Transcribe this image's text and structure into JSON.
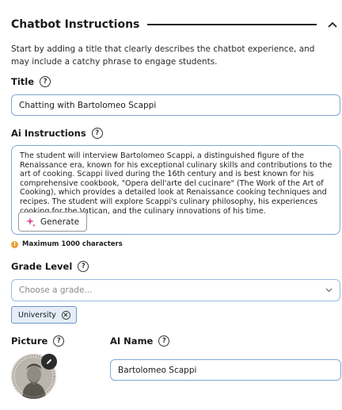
{
  "section": {
    "title": "Chatbot Instructions",
    "collapse_icon": "chevron-up-icon"
  },
  "intro": "Start by adding a title that clearly describes the chatbot experience, and may include a catchy phrase to engage students.",
  "title_field": {
    "label": "Title",
    "help": "?",
    "value": "Chatting with Bartolomeo Scappi"
  },
  "ai_instructions": {
    "label": "Ai Instructions",
    "help": "?",
    "value": "The student will interview Bartolomeo Scappi, a distinguished figure of the Renaissance era, known for his exceptional culinary skills and contributions to the art of cooking. Scappi lived during the 16th century and is best known for his comprehensive cookbook, \"Opera dell'arte del cucinare\" (The Work of the Art of Cooking), which provides a detailed look at Renaissance cooking techniques and recipes. The student will explore Scappi's culinary philosophy, his experiences cooking for the Vatican, and the culinary innovations of his time.",
    "generate_label": "Generate",
    "max_note": "Maximum 1000 characters",
    "warn_glyph": "!"
  },
  "grade_level": {
    "label": "Grade Level",
    "help": "?",
    "placeholder": "Choose a grade...",
    "selected_chips": [
      "University"
    ]
  },
  "picture": {
    "label": "Picture",
    "help": "?"
  },
  "ai_name": {
    "label": "AI Name",
    "help": "?",
    "value": "Bartolomeo Scappi"
  },
  "colors": {
    "accent_border": "#7fa8d6",
    "chip_bg": "#e4edf8",
    "warning": "#e8a13a",
    "generate_sparkle": "#e0529c"
  }
}
